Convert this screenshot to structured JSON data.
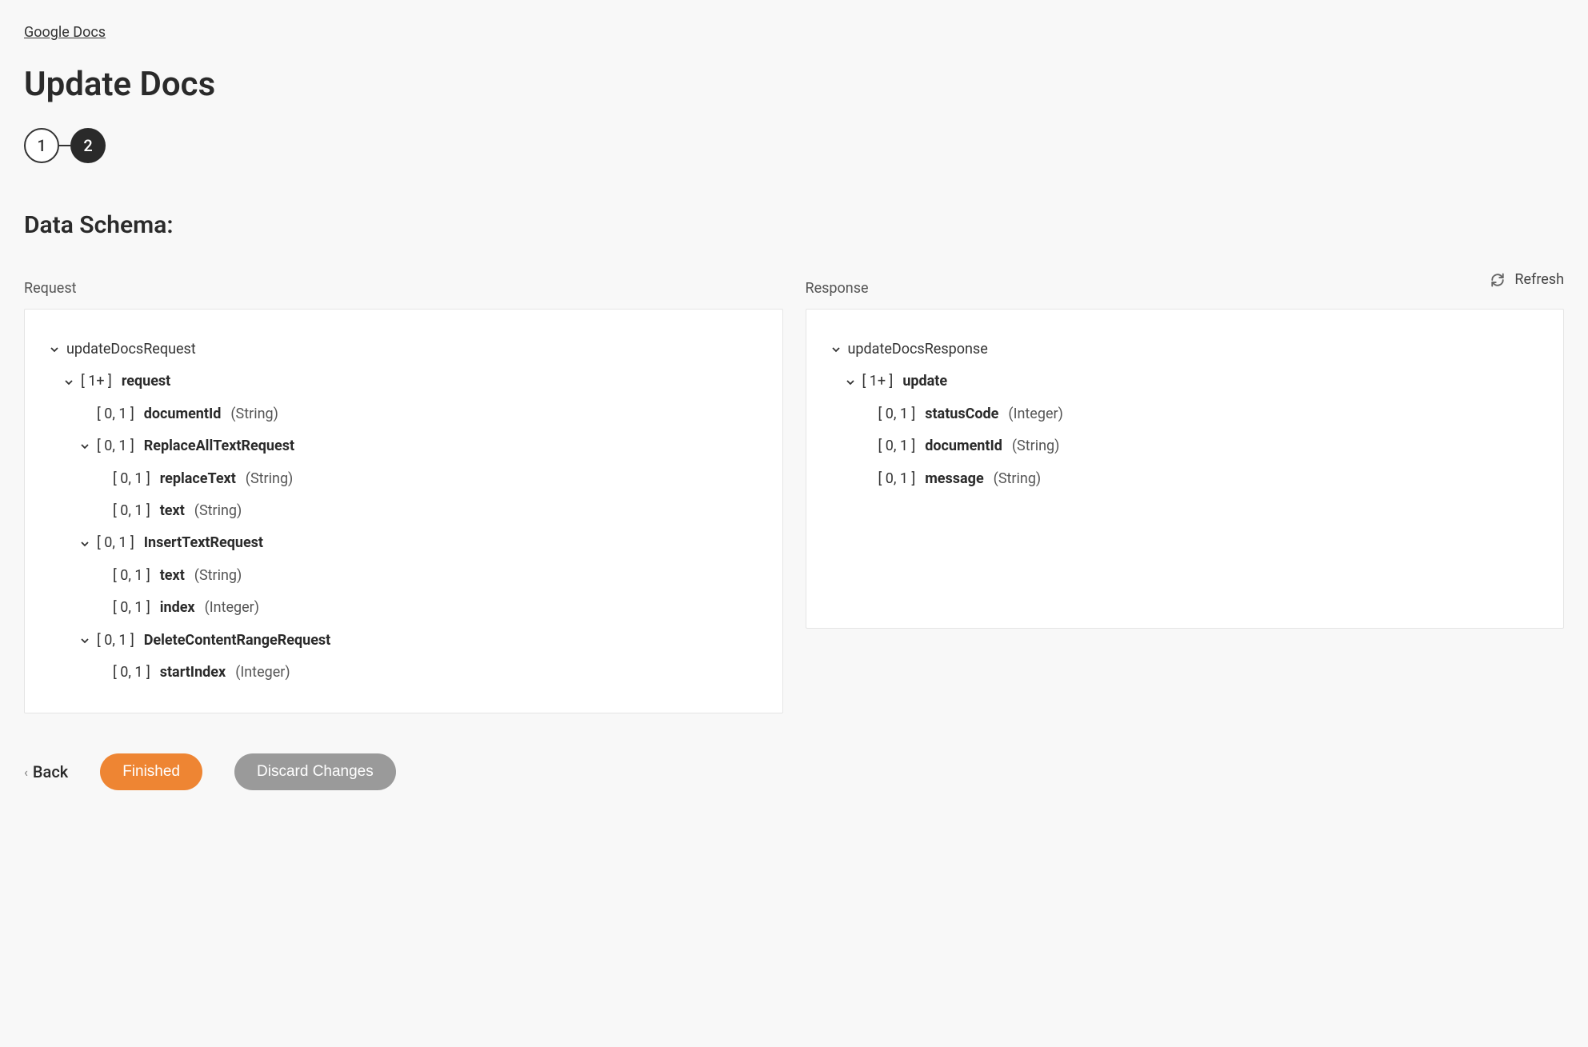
{
  "breadcrumb": "Google Docs",
  "pageTitle": "Update Docs",
  "stepper": {
    "step1": "1",
    "step2": "2"
  },
  "sectionTitle": "Data Schema:",
  "refresh": "Refresh",
  "request": {
    "label": "Request",
    "root": "updateDocsRequest",
    "requestCard": "[ 1+ ]",
    "requestName": "request",
    "documentIdCard": "[ 0, 1 ]",
    "documentIdName": "documentId",
    "documentIdType": "(String)",
    "replaceAllCard": "[ 0, 1 ]",
    "replaceAllName": "ReplaceAllTextRequest",
    "replaceTextCard": "[ 0, 1 ]",
    "replaceTextName": "replaceText",
    "replaceTextType": "(String)",
    "textCard": "[ 0, 1 ]",
    "textName": "text",
    "textType": "(String)",
    "insertTextCard": "[ 0, 1 ]",
    "insertTextName": "InsertTextRequest",
    "insText2Card": "[ 0, 1 ]",
    "insText2Name": "text",
    "insText2Type": "(String)",
    "indexCard": "[ 0, 1 ]",
    "indexName": "index",
    "indexType": "(Integer)",
    "deleteRangeCard": "[ 0, 1 ]",
    "deleteRangeName": "DeleteContentRangeRequest",
    "startIndexCard": "[ 0, 1 ]",
    "startIndexName": "startIndex",
    "startIndexType": "(Integer)"
  },
  "response": {
    "label": "Response",
    "root": "updateDocsResponse",
    "updateCard": "[ 1+ ]",
    "updateName": "update",
    "statusCodeCard": "[ 0, 1 ]",
    "statusCodeName": "statusCode",
    "statusCodeType": "(Integer)",
    "documentIdCard": "[ 0, 1 ]",
    "documentIdName": "documentId",
    "documentIdType": "(String)",
    "messageCard": "[ 0, 1 ]",
    "messageName": "message",
    "messageType": "(String)"
  },
  "footer": {
    "back": "Back",
    "finished": "Finished",
    "discard": "Discard Changes"
  }
}
